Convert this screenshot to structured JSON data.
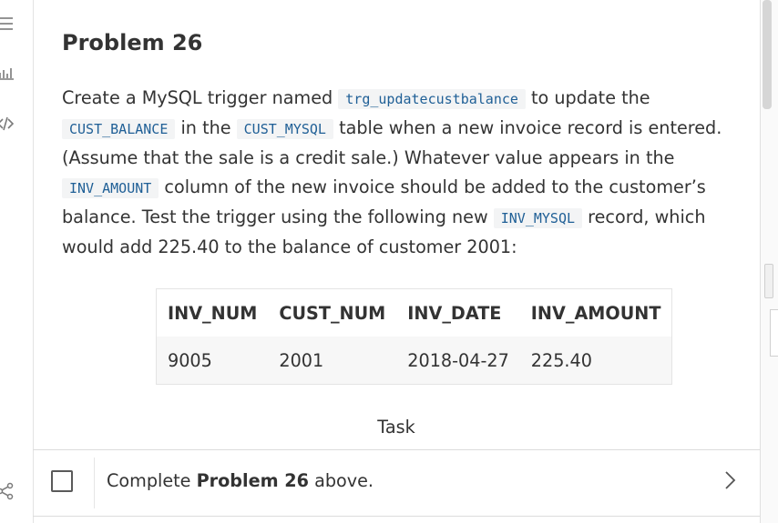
{
  "sidebar": {
    "icons": [
      "list-icon",
      "chart-icon",
      "code-icon",
      "share-icon"
    ]
  },
  "problem": {
    "title": "Problem 26",
    "p1": "Create a MySQL trigger named ",
    "c1": "trg_updatecustbalance",
    "p2": " to update the ",
    "c2": "CUST_BALANCE",
    "p3": " in the ",
    "c3": "CUST_MYSQL",
    "p4": " table when a new invoice record is entered. (Assume that the sale is a credit sale.) Whatever value appears in the ",
    "c4": "INV_AMOUNT",
    "p5": " column of the new invoice should be added to the customer’s balance. Test the trigger using the following new ",
    "c5": "INV_MYSQL",
    "p6": " record, which would add 225.40 to the balance of customer 2001:"
  },
  "table": {
    "headers": [
      "INV_NUM",
      "CUST_NUM",
      "INV_DATE",
      "INV_AMOUNT"
    ],
    "row": [
      "9005",
      "2001",
      "2018-04-27",
      "225.40"
    ]
  },
  "task": {
    "heading": "Task",
    "prefix": "Complete ",
    "bold": "Problem 26",
    "suffix": " above."
  }
}
